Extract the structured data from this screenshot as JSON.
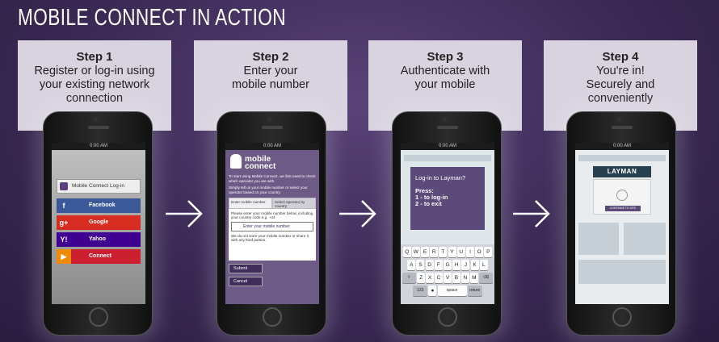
{
  "title": "MOBILE CONNECT IN ACTION",
  "steps": [
    {
      "heading": "Step 1",
      "line1": "Register or log-in using",
      "line2": "your existing network",
      "line3": "connection"
    },
    {
      "heading": "Step 2",
      "line1": "Enter your",
      "line2": "mobile number",
      "line3": ""
    },
    {
      "heading": "Step 3",
      "line1": "Authenticate with",
      "line2": "your mobile",
      "line3": ""
    },
    {
      "heading": "Step 4",
      "line1": "You're in!",
      "line2": "Securely and",
      "line3": "conveniently"
    }
  ],
  "statusbar_time": "0:00 AM",
  "screen1": {
    "login_label": "Mobile Connect Log-in",
    "buttons": [
      {
        "label": "Facebook",
        "icon": "f",
        "color": "#3b5998"
      },
      {
        "label": "Google",
        "icon": "g+",
        "color": "#d62d20"
      },
      {
        "label": "Yahoo",
        "icon": "Y!",
        "color": "#400090"
      },
      {
        "label": "Connect",
        "icon": "",
        "color": "#cc1f2f"
      }
    ]
  },
  "screen2": {
    "brand_line1": "mobile",
    "brand_line2": "connect",
    "intro": "To start using Mobile Connect, we first need to check which operator you are with.",
    "instruction": "Simply tell us your mobile number or select your operator based on your country.",
    "tab1": "Enter mobile number",
    "tab2": "Select operator by country",
    "panel_text": "Please enter your mobile number below, including your country code e.g. +44",
    "field_placeholder": "Enter your mobile number",
    "privacy": "We do not store your mobile number or share it with any third parties.",
    "submit": "Submit",
    "cancel": "Cancel"
  },
  "screen3": {
    "prompt": "Log-in to Layman?",
    "press": "Press:",
    "option1": "1 - to log-in",
    "option2": "2 - to exit",
    "keys_row1": [
      "Q",
      "W",
      "E",
      "R",
      "T",
      "Y",
      "U",
      "I",
      "O",
      "P"
    ],
    "keys_row2": [
      "A",
      "S",
      "D",
      "F",
      "G",
      "H",
      "J",
      "K",
      "L"
    ],
    "keys_row3": [
      "Z",
      "X",
      "C",
      "V",
      "B",
      "N",
      "M"
    ],
    "key_123": "123",
    "key_space": "space",
    "key_return": "return"
  },
  "screen4": {
    "logo": "LAYMAN",
    "card_text": "CONTINUE TO SITE"
  },
  "colors": {
    "background": "#3b2a55",
    "step_box": "#d8d3df",
    "accent": "#5b4a7a"
  }
}
